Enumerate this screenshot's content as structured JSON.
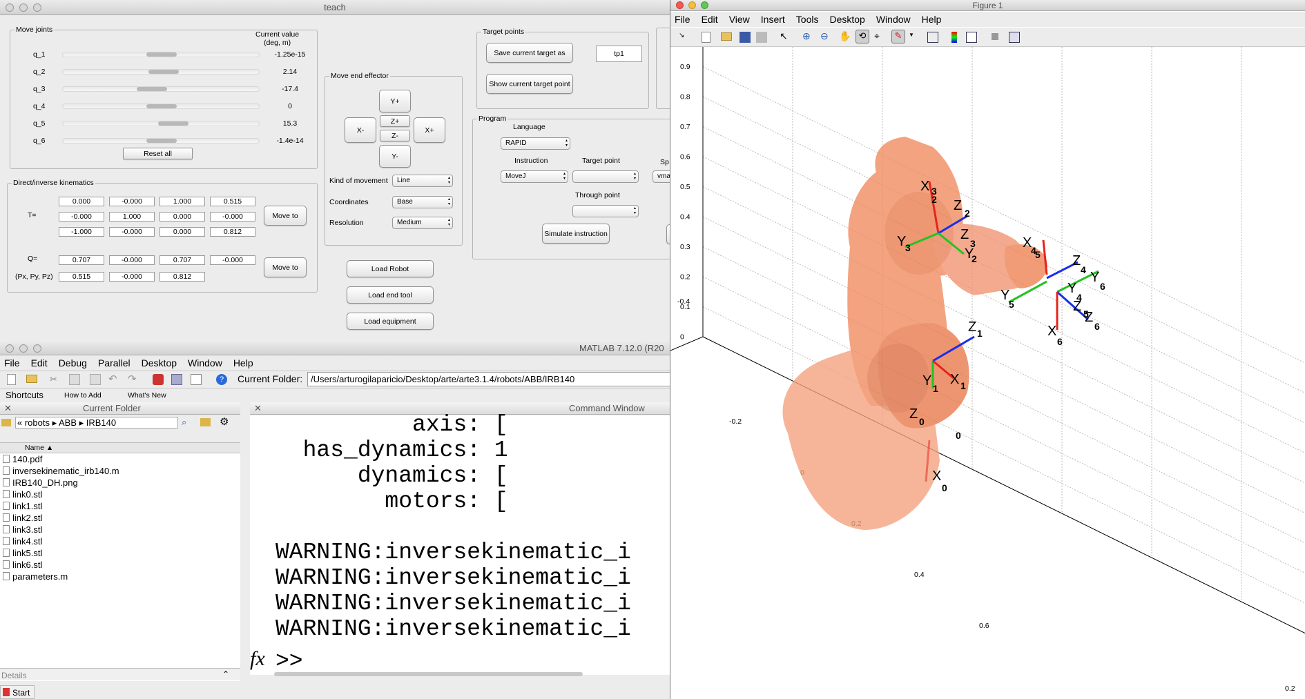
{
  "teach": {
    "title": "teach",
    "move_joints": {
      "legend": "Move joints",
      "header": "Current value\n(deg, m)",
      "joints": [
        {
          "name": "q_1",
          "value": "-1.25e-15",
          "pos": 0.5
        },
        {
          "name": "q_2",
          "value": "2.14",
          "pos": 0.51
        },
        {
          "name": "q_3",
          "value": "-17.4",
          "pos": 0.45
        },
        {
          "name": "q_4",
          "value": "0",
          "pos": 0.5
        },
        {
          "name": "q_5",
          "value": "15.3",
          "pos": 0.56
        },
        {
          "name": "q_6",
          "value": "-1.4e-14",
          "pos": 0.5
        }
      ],
      "reset_label": "Reset all"
    },
    "kinematics": {
      "legend": "Direct/inverse kinematics",
      "t_label": "T=",
      "t_matrix": [
        [
          "0.000",
          "-0.000",
          "1.000",
          "0.515"
        ],
        [
          "-0.000",
          "1.000",
          "0.000",
          "-0.000"
        ],
        [
          "-1.000",
          "-0.000",
          "0.000",
          "0.812"
        ]
      ],
      "q_label": "Q=",
      "q_values": [
        "0.707",
        "-0.000",
        "0.707",
        "-0.000"
      ],
      "p_label": "(Px, Py, Pz)",
      "p_values": [
        "0.515",
        "-0.000",
        "0.812"
      ],
      "move_to": "Move to"
    },
    "end_effector": {
      "legend": "Move end effector",
      "yplus": "Y+",
      "yminus": "Y-",
      "xminus": "X-",
      "xplus": "X+",
      "zplus": "Z+",
      "zminus": "Z-",
      "kind_label": "Kind of movement",
      "kind_value": "Line",
      "coords_label": "Coordinates",
      "coords_value": "Base",
      "res_label": "Resolution",
      "res_value": "Medium"
    },
    "target": {
      "legend": "Target points",
      "save_label": "Save current target as",
      "target_name": "tp1",
      "show_label": "Show current target point"
    },
    "program": {
      "legend": "Program",
      "language_label": "Language",
      "language_value": "RAPID",
      "instruction_label": "Instruction",
      "instruction_value": "MoveJ",
      "target_label": "Target point",
      "speed_label": "Sp",
      "speed_value": "vmax",
      "through_label": "Through point",
      "simulate_label": "Simulate instruction"
    },
    "load_robot": "Load Robot",
    "load_tool": "Load end tool",
    "load_equipment": "Load equipment"
  },
  "matlab": {
    "title": "MATLAB  7.12.0 (R20",
    "menu": [
      "File",
      "Edit",
      "Debug",
      "Parallel",
      "Desktop",
      "Window",
      "Help"
    ],
    "folder_label": "Current Folder:",
    "folder_path": "/Users/arturogilaparicio/Desktop/arte/arte3.1.4/robots/ABB/IRB140",
    "shortcuts": "Shortcuts",
    "how_to_add": "How to Add",
    "whats_new": "What's New",
    "current_folder_title": "Current Folder",
    "breadcrumb": "« robots ▸ ABB ▸ IRB140",
    "name_col": "Name ▲",
    "files": [
      "140.pdf",
      "inversekinematic_irb140.m",
      "IRB140_DH.png",
      "link0.stl",
      "link1.stl",
      "link2.stl",
      "link3.stl",
      "link4.stl",
      "link5.stl",
      "link6.stl",
      "parameters.m"
    ],
    "details": "Details",
    "command_window_title": "Command Window",
    "cmd_lines": [
      "          axis: [",
      "  has_dynamics: 1",
      "      dynamics: [",
      "        motors: [",
      "",
      "WARNING:inversekinematic_i",
      "WARNING:inversekinematic_i",
      "WARNING:inversekinematic_i",
      "WARNING:inversekinematic_i"
    ],
    "prompt": ">>",
    "fx": "fx",
    "start": "Start"
  },
  "figure": {
    "title": "Figure 1",
    "menu": [
      "File",
      "Edit",
      "View",
      "Insert",
      "Tools",
      "Desktop",
      "Window",
      "Help"
    ],
    "z_ticks": [
      "0.9",
      "0.8",
      "0.7",
      "0.6",
      "0.5",
      "0.4",
      "0.3",
      "0.2",
      "0.1",
      "0"
    ],
    "y_ticks": [
      "-0.4",
      "-0.2",
      "0",
      "0.2",
      "0.4",
      "0.6"
    ],
    "x_ticks": [
      "0.2"
    ],
    "frame_labels": [
      "X",
      "2",
      "3",
      "Z",
      "2",
      "Y",
      "3",
      "Z",
      "3",
      "Y",
      "2",
      "X",
      "4",
      "5",
      "Z",
      "4",
      "Y",
      "6",
      "Y",
      "5",
      "Y",
      "4",
      "Z",
      "5",
      "Z",
      "6",
      "X",
      "6",
      "Z",
      "1",
      "Y",
      "1",
      "X",
      "1",
      "Z",
      "0",
      "0",
      "X",
      "0"
    ]
  },
  "colors": {
    "robot": "#f08a5d",
    "x_axis": "#e8231a",
    "y_axis": "#22c322",
    "z_axis": "#1a2ee8"
  }
}
